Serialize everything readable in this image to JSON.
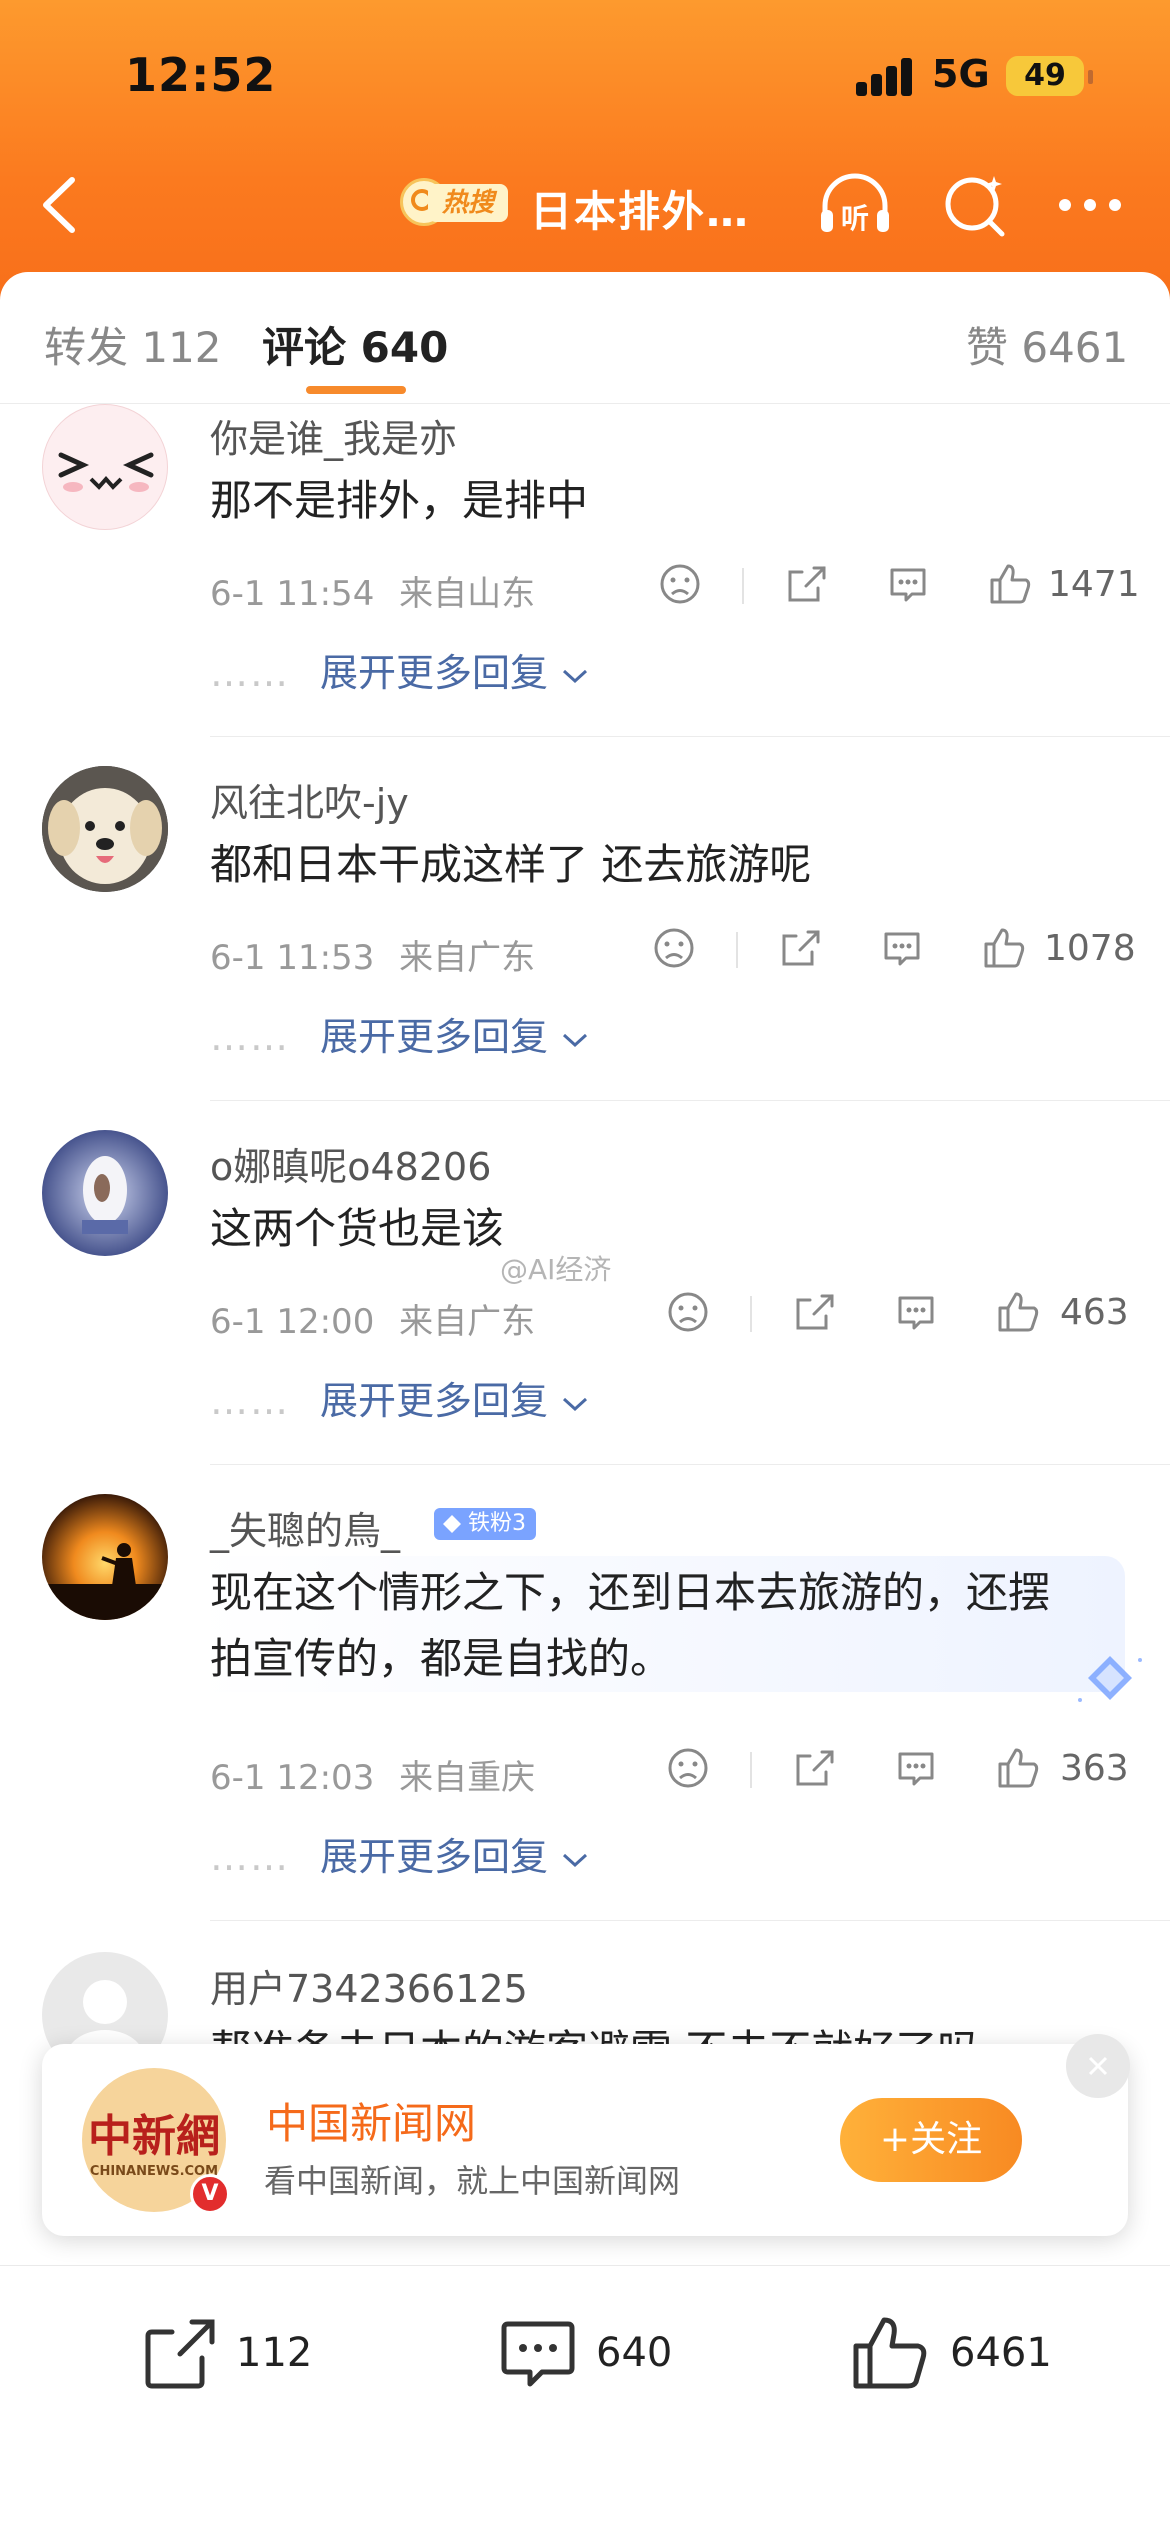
{
  "status_bar": {
    "time": "12:52",
    "network": "5G",
    "battery": "49"
  },
  "nav": {
    "hot_badge": "热搜",
    "title": "日本排外…",
    "listen_label": "听"
  },
  "tabs": {
    "repost": "转发 112",
    "comments": "评论 640",
    "likes": "赞 6461"
  },
  "expand_label": "展开更多回复",
  "expand_dots": "……",
  "comments": [
    {
      "user": "你是谁_我是亦",
      "text": "那不是排外，是排中",
      "time": "6-1 11:54",
      "location": "来自山东",
      "likes": "1471"
    },
    {
      "user": "风往北吹-jy",
      "text": "都和日本干成这样了 还去旅游呢",
      "time": "6-1 11:53",
      "location": "来自广东",
      "likes": "1078"
    },
    {
      "user": "o娜瞋呢o48206",
      "text": "这两个货也是该",
      "time": "6-1 12:00",
      "location": "来自广东",
      "likes": "463"
    },
    {
      "user": "_失聰的鳥_",
      "badge": "铁粉3",
      "text_line1": "现在这个情形之下，还到日本去旅游的，还摆",
      "text_line2": "拍宣传的，都是自找的。",
      "time": "6-1 12:03",
      "location": "来自重庆",
      "likes": "363"
    },
    {
      "user": "用户7342366125",
      "text": "帮准备去日本的游客避雷 不去不就好了吗"
    }
  ],
  "watermark": "@AI经济",
  "popup": {
    "title": "中国新闻网",
    "subtitle": "看中国新闻，就上中国新闻网",
    "follow": "+关注",
    "logo_cn": "中新網",
    "logo_en": "CHINANEWS.COM",
    "verified": "V"
  },
  "bottom_bar": {
    "repost": "112",
    "comments": "640",
    "likes": "6461"
  },
  "colors": {
    "header_orange": "#fb7a1f",
    "accent": "#f78a2c",
    "link_blue": "#4a6aa5"
  },
  "icons": [
    "back-arrow-icon",
    "hot-search-icon",
    "headphones-icon",
    "search-icon",
    "more-icon",
    "dislike-face-icon",
    "share-icon",
    "comment-icon",
    "like-thumb-icon",
    "diamond-icon",
    "close-icon"
  ]
}
